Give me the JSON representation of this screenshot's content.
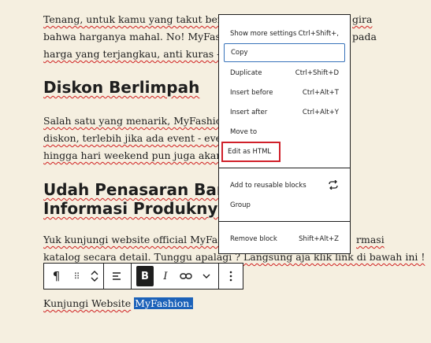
{
  "content": {
    "para1": [
      "Tenang, untuk kamu yang takut berbelanja",
      "gira",
      "bahwa harganya mahal. No! MyFashion",
      "pada",
      "harga yang terjangkau, anti kuras - kura"
    ],
    "heading1": "Diskon Berlimpah",
    "para2": [
      "Salah satu yang menarik, MyFashion se",
      "diskon, terlebih jika ada event - event ,",
      "hingga hari weekend pun juga akan ada"
    ],
    "heading2": [
      "Udah Penasaran Banc",
      "Informasi Produknya"
    ],
    "para3": [
      "Yuk kunjungi website official MyFashio",
      "rmasi",
      "katalog secara detail. Tunggu apalagi ? Langsung aja klik link di bawah ini !"
    ],
    "para4_prefix": "Kunjungi Website",
    "para4_link": "MyFashion."
  },
  "toolbar": {
    "paragraph_icon": "¶",
    "drag_icon": "⠿",
    "bold": "B",
    "italic": "I"
  },
  "menu": {
    "items": [
      {
        "label": "Show more settings",
        "shortcut": "Ctrl+Shift+,"
      },
      {
        "label": "Copy",
        "shortcut": ""
      },
      {
        "label": "Duplicate",
        "shortcut": "Ctrl+Shift+D"
      },
      {
        "label": "Insert before",
        "shortcut": "Ctrl+Alt+T"
      },
      {
        "label": "Insert after",
        "shortcut": "Ctrl+Alt+Y"
      },
      {
        "label": "Move to",
        "shortcut": ""
      },
      {
        "label": "Edit as HTML",
        "shortcut": ""
      },
      {
        "label": "Add to reusable blocks",
        "shortcut": ""
      },
      {
        "label": "Group",
        "shortcut": ""
      },
      {
        "label": "Remove block",
        "shortcut": "Shift+Alt+Z"
      }
    ]
  },
  "colors": {
    "background": "#f5efe0",
    "highlight_border": "#d0202a",
    "focus_border": "#3873ba",
    "selection": "#1c62b9"
  }
}
